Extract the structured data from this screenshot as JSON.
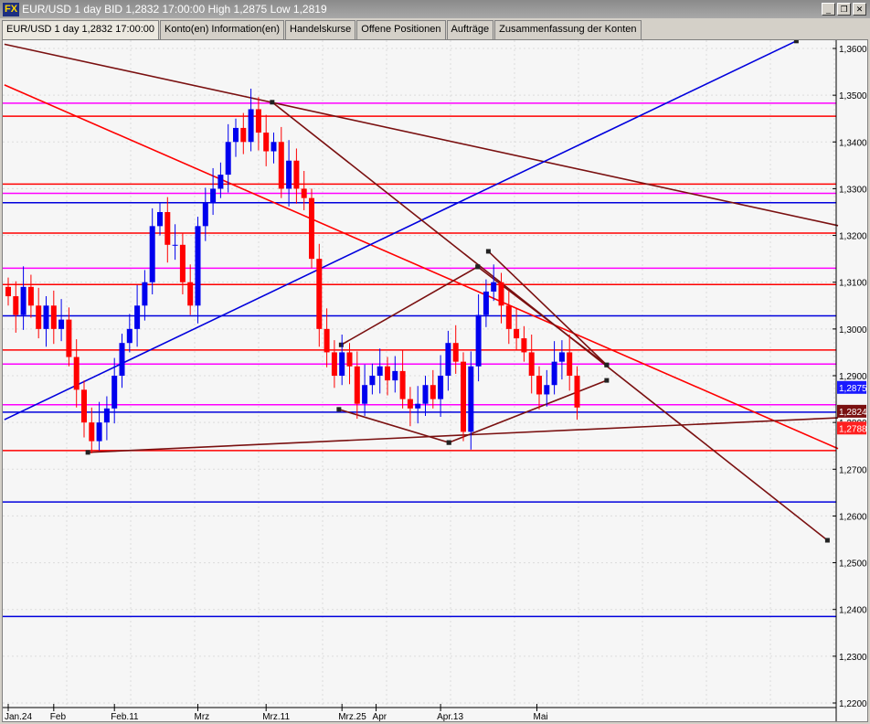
{
  "window": {
    "logo": "FX",
    "title": "EUR/USD 1 day BID 1,2832 17:00:00 High 1,2875 Low 1,2819",
    "buttons": [
      "_",
      "❐",
      "✕"
    ]
  },
  "tabs": [
    "EUR/USD 1 day 1,2832 17:00:00",
    "Konto(en) Information(en)",
    "Handelskurse",
    "Offene Positionen",
    "Aufträge",
    "Zusammenfassung der Konten"
  ],
  "chart_data": {
    "type": "candlestick",
    "symbol": "EUR/USD",
    "timeframe": "1 day",
    "ylim": [
      1.22,
      1.36
    ],
    "y_ticks": [
      "1,3600",
      "1,3500",
      "1,3400",
      "1,3300",
      "1,3200",
      "1,3100",
      "1,3000",
      "1,2900",
      "1,2800",
      "1,2700",
      "1,2600",
      "1,2500",
      "1,2400",
      "1,2300",
      "1,2200"
    ],
    "x_labels": [
      {
        "label": "Jan.24",
        "i": 0
      },
      {
        "label": "Feb",
        "i": 6
      },
      {
        "label": "Feb.11",
        "i": 14
      },
      {
        "label": "Mrz",
        "i": 25
      },
      {
        "label": "Mrz.11",
        "i": 34
      },
      {
        "label": "Mrz.25",
        "i": 44
      },
      {
        "label": "Apr",
        "i": 48.5
      },
      {
        "label": "Apr.13",
        "i": 57
      },
      {
        "label": "Mai",
        "i": 69.7
      }
    ],
    "closes": [
      1.307,
      1.303,
      1.309,
      1.305,
      1.3,
      1.305,
      1.3,
      1.302,
      1.294,
      1.287,
      1.28,
      1.276,
      1.28,
      1.283,
      1.29,
      1.297,
      1.3,
      1.305,
      1.31,
      1.322,
      1.325,
      1.318,
      1.318,
      1.31,
      1.305,
      1.322,
      1.327,
      1.33,
      1.333,
      1.34,
      1.343,
      1.34,
      1.347,
      1.342,
      1.338,
      1.34,
      1.33,
      1.336,
      1.33,
      1.328,
      1.315,
      1.3,
      1.295,
      1.29,
      1.295,
      1.292,
      1.284,
      1.288,
      1.29,
      1.292,
      1.289,
      1.291,
      1.285,
      1.283,
      1.284,
      1.288,
      1.285,
      1.29,
      1.297,
      1.293,
      1.278,
      1.292,
      1.303,
      1.308,
      1.31,
      1.305,
      1.3,
      1.298,
      1.295,
      1.29,
      1.286,
      1.288,
      1.293,
      1.295,
      1.29,
      1.2832
    ],
    "price_tags": [
      {
        "label": "1,2875",
        "price": 1.2875,
        "color": "#1a1aff"
      },
      {
        "label": "1,2824",
        "price": 1.2824,
        "color": "#7a1010"
      },
      {
        "label": "1,2788",
        "price": 1.2788,
        "color": "#ff2020"
      }
    ],
    "hlines": [
      {
        "p": 1.3483,
        "c": "#ff00ff"
      },
      {
        "p": 1.3455,
        "c": "#ff0000"
      },
      {
        "p": 1.331,
        "c": "#ff0000"
      },
      {
        "p": 1.329,
        "c": "#ff00ff"
      },
      {
        "p": 1.327,
        "c": "#0000dd"
      },
      {
        "p": 1.3205,
        "c": "#ff0000"
      },
      {
        "p": 1.313,
        "c": "#ff00ff"
      },
      {
        "p": 1.3095,
        "c": "#ff0000"
      },
      {
        "p": 1.3028,
        "c": "#0000dd"
      },
      {
        "p": 1.2955,
        "c": "#ff0000"
      },
      {
        "p": 1.2925,
        "c": "#ff00ff"
      },
      {
        "p": 1.2838,
        "c": "#ff00ff"
      },
      {
        "p": 1.2822,
        "c": "#0000dd"
      },
      {
        "p": 1.274,
        "c": "#ff0000"
      },
      {
        "p": 1.263,
        "c": "#0000dd"
      },
      {
        "p": 1.2385,
        "c": "#0000dd"
      }
    ],
    "trendlines": [
      {
        "a": [
          -0.5,
          1.3609
        ],
        "b": [
          109.4,
          1.3221
        ],
        "c": "#7a1010"
      },
      {
        "a": [
          -0.5,
          1.3522
        ],
        "b": [
          109.4,
          1.2744
        ],
        "c": "#ff0000"
      },
      {
        "a": [
          -0.5,
          1.2806
        ],
        "b": [
          103.9,
          1.3616
        ],
        "c": "#0000dd"
      },
      {
        "a": [
          34.8,
          1.3485
        ],
        "b": [
          108,
          1.2548
        ],
        "c": "#7a1010"
      },
      {
        "a": [
          63.3,
          1.3166
        ],
        "b": [
          78.9,
          1.2923
        ],
        "c": "#7a1010"
      },
      {
        "a": [
          43.9,
          1.2966
        ],
        "b": [
          61.9,
          1.3133
        ],
        "c": "#7a1010"
      },
      {
        "a": [
          61.9,
          1.3133
        ],
        "b": [
          78.9,
          1.2923
        ],
        "c": "#7a1010"
      },
      {
        "a": [
          43.6,
          1.2828
        ],
        "b": [
          58.1,
          1.2757
        ],
        "c": "#7a1010"
      },
      {
        "a": [
          58.1,
          1.2757
        ],
        "b": [
          78.9,
          1.289
        ],
        "c": "#7a1010"
      },
      {
        "a": [
          10.5,
          1.2736
        ],
        "b": [
          109.4,
          1.281
        ],
        "c": "#7a1010"
      }
    ]
  }
}
